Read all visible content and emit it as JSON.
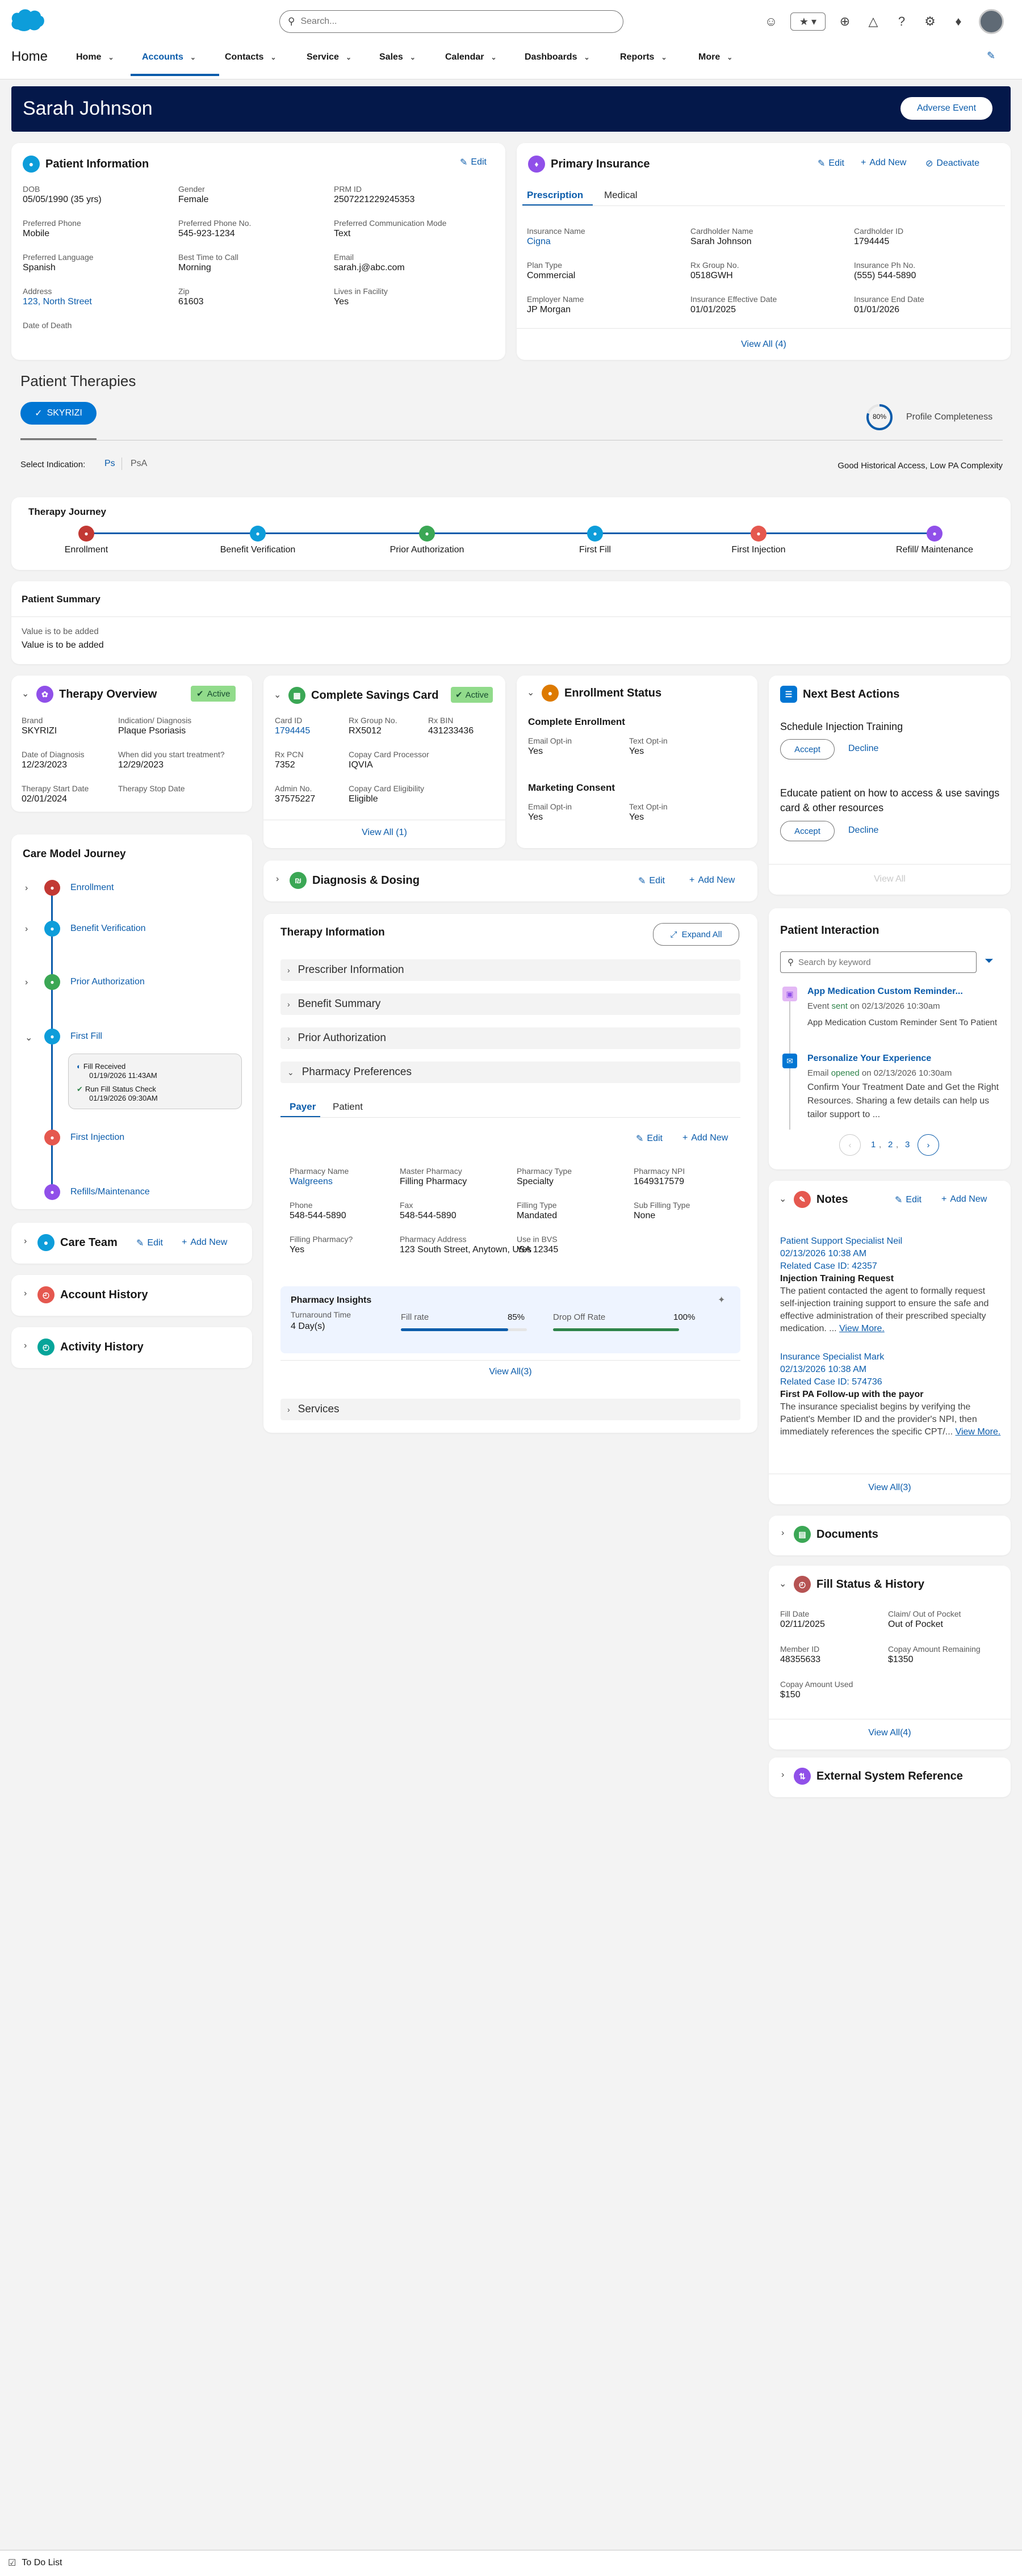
{
  "header": {
    "search_placeholder": "Search...",
    "app_name": "Home",
    "nav": [
      "Home",
      "Accounts",
      "Contacts",
      "Service",
      "Sales",
      "Calendar",
      "Dashboards",
      "Reports",
      "More"
    ]
  },
  "banner": {
    "name": "Sarah Johnson",
    "adverse_btn": "Adverse Event"
  },
  "patient_info": {
    "title": "Patient Information",
    "edit": "Edit",
    "fields": [
      {
        "label": "DOB",
        "value": "05/05/1990 (35 yrs)"
      },
      {
        "label": "Gender",
        "value": "Female"
      },
      {
        "label": "PRM ID",
        "value": "2507221229245353"
      },
      {
        "label": "Preferred Phone",
        "value": "Mobile"
      },
      {
        "label": "Preferred Phone No.",
        "value": "545-923-1234"
      },
      {
        "label": "Preferred Communication Mode",
        "value": "Text"
      },
      {
        "label": "Preferred Language",
        "value": "Spanish"
      },
      {
        "label": "Best Time to Call",
        "value": "Morning"
      },
      {
        "label": "Email",
        "value": "sarah.j@abc.com"
      },
      {
        "label": "Address",
        "value": "123, North Street"
      },
      {
        "label": "Zip",
        "value": "61603"
      },
      {
        "label": "Lives in Facility",
        "value": "Yes"
      },
      {
        "label": "Date of Death",
        "value": ""
      }
    ]
  },
  "insurance": {
    "title": "Primary Insurance",
    "edit": "Edit",
    "add_new": "Add New",
    "deactivate": "Deactivate",
    "tabs": [
      "Prescription",
      "Medical"
    ],
    "fields": [
      {
        "label": "Insurance Name",
        "value": "Cigna"
      },
      {
        "label": "Cardholder Name",
        "value": "Sarah Johnson"
      },
      {
        "label": "Cardholder ID",
        "value": "1794445"
      },
      {
        "label": "Plan Type",
        "value": "Commercial"
      },
      {
        "label": "Rx Group No.",
        "value": "0518GWH"
      },
      {
        "label": "Insurance Ph No.",
        "value": "(555) 544-5890"
      },
      {
        "label": "Employer Name",
        "value": "JP Morgan"
      },
      {
        "label": "Insurance Effective Date",
        "value": "01/01/2025"
      },
      {
        "label": "Insurance End Date",
        "value": "01/01/2026"
      }
    ],
    "view_all": "View All (4)"
  },
  "therapies": {
    "title": "Patient Therapies",
    "tab": "SKYRIZI",
    "completeness_pct": "80%",
    "completeness_label": "Profile Completeness",
    "indication_label": "Select Indication:",
    "indications": [
      "Ps",
      "PsA"
    ],
    "access_note": "Good Historical Access, Low PA Complexity"
  },
  "journey": {
    "title": "Therapy Journey",
    "steps": [
      "Enrollment",
      "Benefit Verification",
      "Prior Authorization",
      "First Fill",
      "First Injection",
      "Refill/ Maintenance"
    ],
    "colors": [
      "#c23934",
      "#0d9dda",
      "#3ba755",
      "#0d9dda",
      "#e5584f",
      "#9050e9"
    ]
  },
  "summary": {
    "title": "Patient Summary",
    "line1": "Value is to be added",
    "line2": "Value is to be added"
  },
  "overview": {
    "title": "Therapy Overview",
    "badge": "Active",
    "fields": [
      {
        "label": "Brand",
        "value": "SKYRIZI"
      },
      {
        "label": "Indication/ Diagnosis",
        "value": "Plaque Psoriasis"
      },
      {
        "label": "Date of Diagnosis",
        "value": "12/23/2023"
      },
      {
        "label": "When did you start treatment?",
        "value": "12/29/2023"
      },
      {
        "label": "Therapy Start Date",
        "value": "02/01/2024"
      },
      {
        "label": "Therapy Stop Date",
        "value": ""
      }
    ]
  },
  "savings": {
    "title": "Complete Savings Card",
    "badge": "Active",
    "fields": [
      {
        "label": "Card ID",
        "value": "1794445"
      },
      {
        "label": "Rx Group No.",
        "value": "RX5012"
      },
      {
        "label": "Rx BIN",
        "value": "431233436"
      },
      {
        "label": "Rx PCN",
        "value": "7352"
      },
      {
        "label": "Copay Card Processor",
        "value": "IQVIA"
      },
      {
        "label": "Admin No.",
        "value": "37575227"
      },
      {
        "label": "Copay Card Eligibility",
        "value": "Eligible"
      }
    ],
    "view_all": "View All (1)"
  },
  "enrollment": {
    "title": "Enrollment Status",
    "sections": [
      {
        "title": "Complete Enrollment",
        "email_label": "Email Opt-in",
        "email": "Yes",
        "text_label": "Text Opt-in",
        "text": "Yes"
      },
      {
        "title": "Marketing Consent",
        "email_label": "Email Opt-in",
        "email": "Yes",
        "text_label": "Text Opt-in",
        "text": "Yes"
      }
    ]
  },
  "nba": {
    "title": "Next Best Actions",
    "items": [
      {
        "text": "Schedule Injection Training"
      },
      {
        "text": "Educate patient on how to access & use savings card & other resources"
      }
    ],
    "accept": "Accept",
    "decline": "Decline",
    "view_all": "View All"
  },
  "care_model": {
    "title": "Care Model Journey",
    "steps": [
      "Enrollment",
      "Benefit Verification",
      "Prior Authorization",
      "First Fill",
      "First Injection",
      "Refills/Maintenance"
    ],
    "fill_received": "Fill Received",
    "fill_received_date": "01/19/2026 11:43AM",
    "run_check": "Run Fill Status Check",
    "run_check_date": "01/19/2026 09:30AM"
  },
  "care_team": {
    "title": "Care Team",
    "edit": "Edit",
    "add_new": "Add New"
  },
  "account_history": {
    "title": "Account History"
  },
  "activity_history": {
    "title": "Activity History"
  },
  "dosing": {
    "title": "Diagnosis & Dosing",
    "edit": "Edit",
    "add_new": "Add New"
  },
  "therapy_info": {
    "title": "Therapy Information",
    "expand": "Expand All",
    "sections": [
      "Prescriber Information",
      "Benefit Summary",
      "Prior Authorization",
      "Pharmacy Preferences"
    ],
    "tabs": [
      "Payer",
      "Patient"
    ],
    "edit": "Edit",
    "add_new": "Add New",
    "pharmacy": [
      {
        "label": "Pharmacy Name",
        "value": "Walgreens"
      },
      {
        "label": "Master Pharmacy",
        "value": "Filling Pharmacy"
      },
      {
        "label": "Pharmacy Type",
        "value": "Specialty"
      },
      {
        "label": "Pharmacy NPI",
        "value": "1649317579"
      },
      {
        "label": "Phone",
        "value": "548-544-5890"
      },
      {
        "label": "Fax",
        "value": "548-544-5890"
      },
      {
        "label": "Filling Type",
        "value": "Mandated"
      },
      {
        "label": "Sub Filling Type",
        "value": "None"
      },
      {
        "label": "Filling Pharmacy?",
        "value": "Yes"
      },
      {
        "label": "Pharmacy Address",
        "value": "123 South Street, Anytown, USA 12345"
      },
      {
        "label": "Use in BVS",
        "value": "Yes"
      }
    ],
    "insights_title": "Pharmacy Insights",
    "turnaround_label": "Turnaround Time",
    "turnaround": "4 Day(s)",
    "fill_rate_label": "Fill rate",
    "fill_rate": "85%",
    "fill_rate_value": 0.85,
    "drop_label": "Drop Off Rate",
    "drop": "100%",
    "drop_value": 1.0,
    "view_all": "View All(3)",
    "services": "Services"
  },
  "interaction": {
    "title": "Patient Interaction",
    "search_placeholder": "Search by keyword",
    "items": [
      {
        "title": "App Medication Custom Reminder...",
        "status_pre": "Event",
        "status": "sent",
        "status_post": "on 02/13/2026 10:30am",
        "body": "App Medication Custom Reminder Sent To Patient"
      },
      {
        "title": "Personalize Your Experience",
        "status_pre": "Email",
        "status": "opened",
        "status_post": "on 02/13/2026 10:30am",
        "body": "Confirm Your Treatment Date and Get the Right Resources. Sharing a few details can help us tailor support to ..."
      }
    ],
    "pages": [
      "1",
      "2",
      "3"
    ]
  },
  "notes": {
    "title": "Notes",
    "edit": "Edit",
    "add_new": "Add New",
    "items": [
      {
        "author": "Patient Support Specialist Neil",
        "date": "02/13/2026 10:38 AM",
        "case": "Related Case ID: 42357",
        "subject": "Injection Training Request",
        "body": "The patient contacted the agent to formally request self-injection training support to ensure the safe and effective administration of their prescribed specialty medication. ...",
        "more": "View More."
      },
      {
        "author": "Insurance Specialist Mark",
        "date": "02/13/2026 10:38 AM",
        "case": "Related Case ID: 574736",
        "subject": "First PA Follow-up with the payor",
        "body": "The insurance specialist begins by verifying the Patient's Member ID and the provider's NPI, then immediately references the specific CPT/...",
        "more": "View More."
      }
    ],
    "view_all": "View All(3)"
  },
  "documents": {
    "title": "Documents"
  },
  "fill_status": {
    "title": "Fill Status & History",
    "fields": [
      {
        "label": "Fill Date",
        "value": "02/11/2025"
      },
      {
        "label": "Claim/ Out of Pocket",
        "value": "Out of Pocket"
      },
      {
        "label": "Member ID",
        "value": "48355633"
      },
      {
        "label": "Copay Amount Remaining",
        "value": "$1350"
      },
      {
        "label": "Copay Amount Used",
        "value": "$150"
      }
    ],
    "view_all": "View All(4)"
  },
  "external": {
    "title": "External System Reference"
  },
  "footer": {
    "todo": "To Do List"
  }
}
